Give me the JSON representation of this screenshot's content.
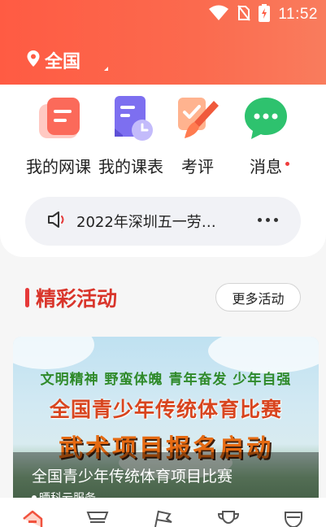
{
  "statusbar": {
    "time": "11:52"
  },
  "location": {
    "label": "全国"
  },
  "nav": [
    {
      "label": "我的网课",
      "icon": "doc-list-icon"
    },
    {
      "label": "我的课表",
      "icon": "schedule-clock-icon"
    },
    {
      "label": "考评",
      "icon": "brush-check-icon"
    },
    {
      "label": "消息",
      "icon": "chat-bubble-icon",
      "badge": true
    }
  ],
  "notice": {
    "text": "2022年深圳五一劳…"
  },
  "section": {
    "title": "精彩活动",
    "more_label": "更多活动"
  },
  "banner": {
    "slogan": "文明精神 野蛮体魄 青年奋发 少年自强",
    "heading": "全国青少年传统体育比赛",
    "subheading": "武术项目报名启动",
    "title": "全国青少年传统体育项目比赛",
    "org": "晒科云服务"
  },
  "tabs": [
    "home-icon",
    "course-icon",
    "flag-icon",
    "trophy-icon",
    "profile-icon"
  ],
  "colors": {
    "accent": "#ff5b43",
    "title_red": "#d9352b"
  }
}
